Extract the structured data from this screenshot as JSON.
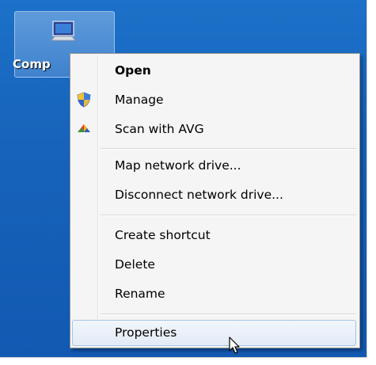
{
  "desktop": {
    "icon_label": "Comp",
    "icon_name": "computer-icon"
  },
  "context_menu": {
    "items": [
      {
        "label": "Open",
        "bold": true,
        "icon": null
      },
      {
        "label": "Manage",
        "bold": false,
        "icon": "uac-shield-icon"
      },
      {
        "label": "Scan with AVG",
        "bold": false,
        "icon": "avg-icon"
      },
      {
        "label": "Map network drive...",
        "bold": false,
        "icon": null
      },
      {
        "label": "Disconnect network drive...",
        "bold": false,
        "icon": null
      },
      {
        "label": "Create shortcut",
        "bold": false,
        "icon": null
      },
      {
        "label": "Delete",
        "bold": false,
        "icon": null
      },
      {
        "label": "Rename",
        "bold": false,
        "icon": null
      },
      {
        "label": "Properties",
        "bold": false,
        "icon": null,
        "hovered": true
      }
    ]
  },
  "colors": {
    "desktop_blue": "#1763bb",
    "menu_bg": "#f5f5f5",
    "hover_border": "#a8c4e6"
  }
}
